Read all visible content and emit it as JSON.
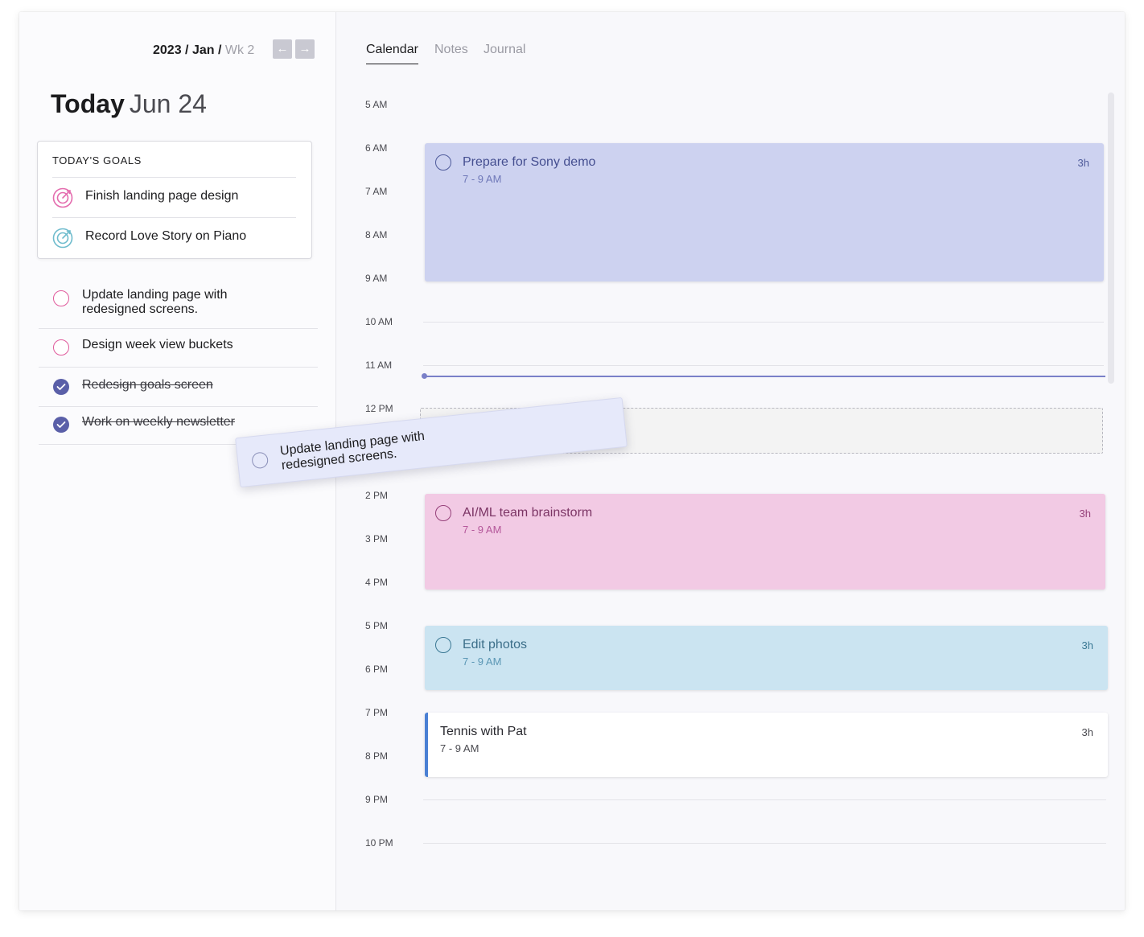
{
  "breadcrumb": {
    "year": "2023",
    "sep1": " / ",
    "month": "Jan",
    "sep2": " / ",
    "week": "Wk 2"
  },
  "nav": {
    "prev_icon": "arrow-left-icon",
    "next_icon": "arrow-right-icon",
    "prev_glyph": "←",
    "next_glyph": "→"
  },
  "heading": {
    "today": "Today",
    "date": "Jun 24"
  },
  "goals": {
    "title": "TODAY'S GOALS",
    "items": [
      {
        "label": "Finish landing page design",
        "icon": "target-icon",
        "color": "#e46cae"
      },
      {
        "label": "Record Love Story on Piano",
        "icon": "target-icon",
        "color": "#6fbccd"
      }
    ]
  },
  "tasks": [
    {
      "label": "Update landing page with redesigned screens.",
      "done": false
    },
    {
      "label": "Design week view buckets",
      "done": false
    },
    {
      "label": "Redesign goals screen",
      "done": true
    },
    {
      "label": "Work on weekly newsletter",
      "done": true
    }
  ],
  "tabs": [
    {
      "label": "Calendar",
      "active": true
    },
    {
      "label": "Notes",
      "active": false
    },
    {
      "label": "Journal",
      "active": false
    }
  ],
  "hours": [
    "5 AM",
    "6 AM",
    "7 AM",
    "8 AM",
    "9 AM",
    "10 AM",
    "11 AM",
    "12 PM",
    "2 PM",
    "3 PM",
    "4 PM",
    "5 PM",
    "6 PM",
    "7 PM",
    "8 PM",
    "9 PM",
    "10 PM"
  ],
  "events": [
    {
      "title": "Prepare for Sony demo",
      "time": "7 - 9 AM",
      "duration": "3h",
      "color": "#cdd2f0"
    },
    {
      "title": "AI/ML team brainstorm",
      "time": "7 - 9 AM",
      "duration": "3h",
      "color": "#f2cae4"
    },
    {
      "title": "Edit photos",
      "time": "7 - 9 AM",
      "duration": "3h",
      "color": "#cbe4f1"
    },
    {
      "title": "Tennis with Pat",
      "time": "7 - 9 AM",
      "duration": "3h",
      "color": "#ffffff"
    }
  ],
  "drag_card": {
    "label": "Update landing page with redesigned screens."
  },
  "colors": {
    "accent": "#5a5fa8",
    "now_line": "#7a80c8",
    "tennis_bar": "#4a80d4"
  }
}
